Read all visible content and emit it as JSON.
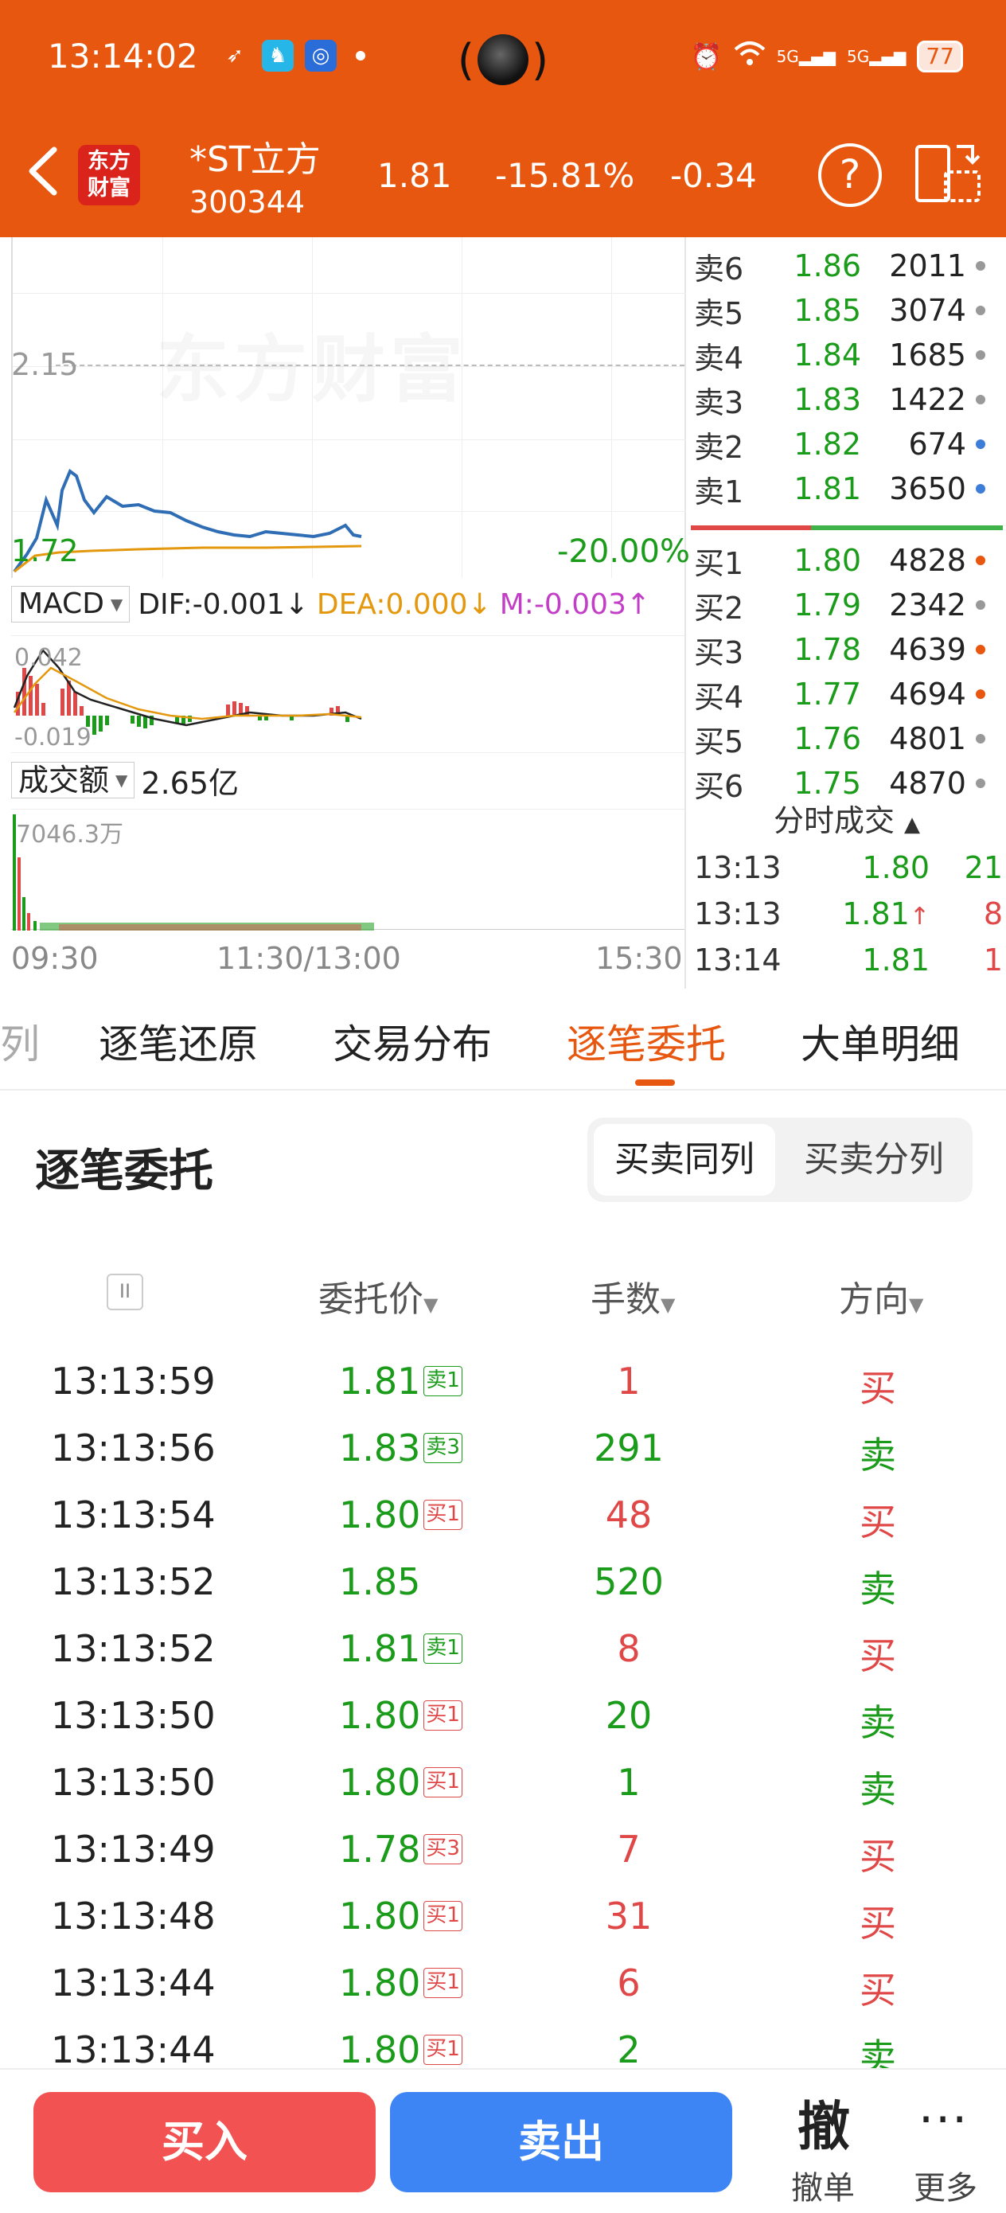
{
  "status_bar": {
    "time": "13:14:02",
    "battery": "77",
    "net1": "5G",
    "net2": "5G"
  },
  "header": {
    "logo_line1": "东方",
    "logo_line2": "财富",
    "name": "*ST立方",
    "code": "300344",
    "price": "1.81",
    "change_pct": "-15.81%",
    "change": "-0.34",
    "help": "?"
  },
  "chart": {
    "watermark": "东方财富",
    "high_label": "2.15",
    "low_label": "1.72",
    "low_pct": "-20.00%",
    "macd_selector": "MACD",
    "dif": "DIF:-0.001",
    "dea": "DEA:0.000",
    "m": "M:-0.003",
    "macd_top": "0.042",
    "macd_bottom": "-0.019",
    "volume_selector": "成交额",
    "volume_total": "2.65亿",
    "volume_max": "7046.3万",
    "time_start": "09:30",
    "time_mid": "11:30/13:00",
    "time_end": "15:30",
    "colors": {
      "up": "#e04848",
      "down": "#1a9b1a",
      "price_line": "#2f6db5",
      "avg_line": "#e3980e"
    }
  },
  "order_book": {
    "asks": [
      {
        "label": "卖6",
        "price": "1.86",
        "qty": "2011",
        "dot": "#999999"
      },
      {
        "label": "卖5",
        "price": "1.85",
        "qty": "3074",
        "dot": "#999999"
      },
      {
        "label": "卖4",
        "price": "1.84",
        "qty": "1685",
        "dot": "#999999"
      },
      {
        "label": "卖3",
        "price": "1.83",
        "qty": "1422",
        "dot": "#999999"
      },
      {
        "label": "卖2",
        "price": "1.82",
        "qty": "674",
        "dot": "#3b7dd8"
      },
      {
        "label": "卖1",
        "price": "1.81",
        "qty": "3650",
        "dot": "#3b7dd8"
      }
    ],
    "bids": [
      {
        "label": "买1",
        "price": "1.80",
        "qty": "4828",
        "dot": "#e8570f"
      },
      {
        "label": "买2",
        "price": "1.79",
        "qty": "2342",
        "dot": "#999999"
      },
      {
        "label": "买3",
        "price": "1.78",
        "qty": "4639",
        "dot": "#e8570f"
      },
      {
        "label": "买4",
        "price": "1.77",
        "qty": "4694",
        "dot": "#e8570f"
      },
      {
        "label": "买5",
        "price": "1.76",
        "qty": "4801",
        "dot": "#999999"
      },
      {
        "label": "买6",
        "price": "1.75",
        "qty": "4870",
        "dot": "#999999"
      }
    ],
    "time_sales_title": "分时成交",
    "time_sales": [
      {
        "time": "13:13",
        "price": "1.80",
        "vol": "21",
        "vol_color": "#1a9b1a",
        "arrow": ""
      },
      {
        "time": "13:13",
        "price": "1.81",
        "vol": "8",
        "vol_color": "#e04848",
        "arrow": "↑"
      },
      {
        "time": "13:14",
        "price": "1.81",
        "vol": "1",
        "vol_color": "#e04848",
        "arrow": ""
      }
    ]
  },
  "tabs": [
    {
      "label": "列"
    },
    {
      "label": "逐笔还原"
    },
    {
      "label": "交易分布"
    },
    {
      "label": "逐笔委托"
    },
    {
      "label": "大单明细"
    }
  ],
  "entrust": {
    "title": "逐笔委托",
    "toggle_same": "买卖同列",
    "toggle_split": "买卖分列",
    "pause": "II",
    "col_price": "委托价",
    "col_qty": "手数",
    "col_dir": "方向",
    "rows": [
      {
        "time": "13:13:59",
        "price": "1.81",
        "tag": "卖1",
        "tag_type": "sell",
        "qty": "1",
        "dir": "买",
        "side": "buy"
      },
      {
        "time": "13:13:56",
        "price": "1.83",
        "tag": "卖3",
        "tag_type": "sell",
        "qty": "291",
        "dir": "卖",
        "side": "sell"
      },
      {
        "time": "13:13:54",
        "price": "1.80",
        "tag": "买1",
        "tag_type": "buy",
        "qty": "48",
        "dir": "买",
        "side": "buy"
      },
      {
        "time": "13:13:52",
        "price": "1.85",
        "tag": "",
        "tag_type": "",
        "qty": "520",
        "dir": "卖",
        "side": "sell"
      },
      {
        "time": "13:13:52",
        "price": "1.81",
        "tag": "卖1",
        "tag_type": "sell",
        "qty": "8",
        "dir": "买",
        "side": "buy"
      },
      {
        "time": "13:13:50",
        "price": "1.80",
        "tag": "买1",
        "tag_type": "buy",
        "qty": "20",
        "dir": "卖",
        "side": "sell"
      },
      {
        "time": "13:13:50",
        "price": "1.80",
        "tag": "买1",
        "tag_type": "buy",
        "qty": "1",
        "dir": "卖",
        "side": "sell"
      },
      {
        "time": "13:13:49",
        "price": "1.78",
        "tag": "买3",
        "tag_type": "buy",
        "qty": "7",
        "dir": "买",
        "side": "buy"
      },
      {
        "time": "13:13:48",
        "price": "1.80",
        "tag": "买1",
        "tag_type": "buy",
        "qty": "31",
        "dir": "买",
        "side": "buy"
      },
      {
        "time": "13:13:44",
        "price": "1.80",
        "tag": "买1",
        "tag_type": "buy",
        "qty": "6",
        "dir": "买",
        "side": "buy"
      },
      {
        "time": "13:13:44",
        "price": "1.80",
        "tag": "买1",
        "tag_type": "buy",
        "qty": "2",
        "dir": "卖",
        "side": "sell"
      }
    ]
  },
  "bottom_bar": {
    "buy": "买入",
    "sell": "卖出",
    "cancel_glyph": "撤",
    "cancel": "撤单",
    "more": "更多"
  }
}
